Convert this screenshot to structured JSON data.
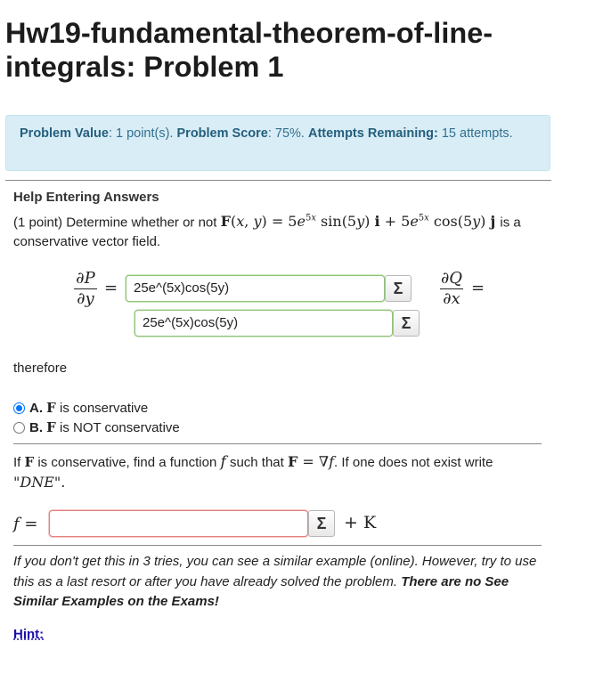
{
  "page": {
    "title": "Hw19-fundamental-theorem-of-line-integrals: Problem 1"
  },
  "info": {
    "problem_value_label": "Problem Value",
    "problem_value": ": 1 point(s).",
    "problem_score_label": "Problem Score",
    "problem_score": ": 75%.",
    "attempts_label": "Attempts Remaining:",
    "attempts_value": "15 attempts."
  },
  "help": {
    "link_text": "Help Entering Answers"
  },
  "problem": {
    "points": "(1 point) Determine whether or not",
    "formula": "F(x, y) = 5e^{5x} sin(5y) i + 5e^{5x} cos(5y) j",
    "suffix": "is a conservative vector field."
  },
  "partials": {
    "dp_num": "∂P",
    "dp_den": "∂y",
    "dq_num": "∂Q",
    "dq_den": "∂x",
    "equals": "=",
    "answer1": "25e^(5x)cos(5y)",
    "answer2": "25e^(5x)cos(5y)",
    "sigma": "Σ"
  },
  "therefore": "therefore",
  "choices": [
    {
      "letter": "A.",
      "bold": "F",
      "text": "is conservative",
      "selected": true
    },
    {
      "letter": "B.",
      "bold": "F",
      "text": "is NOT conservative",
      "selected": false
    }
  ],
  "part2": {
    "prefix": "If",
    "bold_f": "F",
    "mid1": "is conservative, find a function",
    "f": "f",
    "mid2": "such that",
    "eq": "F = ∇f",
    "mid3": ". If one does not exist write",
    "dne": "\"DNE\"."
  },
  "f_row": {
    "label": "f =",
    "value": "",
    "plus_k": "+ K"
  },
  "note": {
    "text": "If you don't get this in 3 tries, you can see a similar example (online). However, try to use this as a last resort or after you have already solved the problem.",
    "bold": "There are no See Similar Examples on the Exams!"
  },
  "hint": "Hint:"
}
